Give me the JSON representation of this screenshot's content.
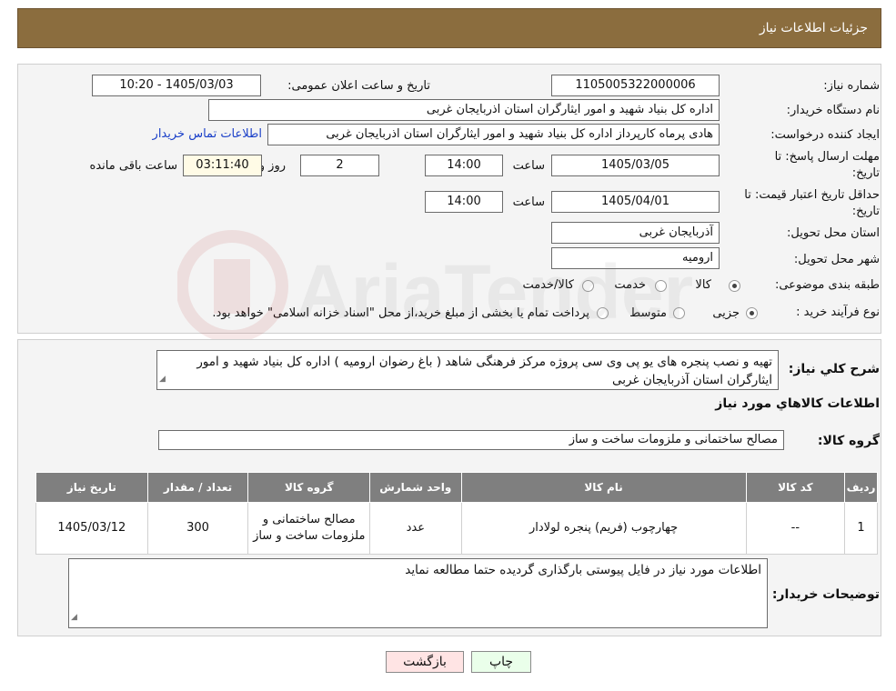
{
  "header": {
    "title": "جزئیات اطلاعات نیاز"
  },
  "form": {
    "need_number": {
      "label": "شماره نیاز:",
      "value": "1105005322000006"
    },
    "announce_datetime": {
      "label": "تاریخ و ساعت اعلان عمومی:",
      "value": "1405/03/03 - 10:20"
    },
    "buyer_org": {
      "label": "نام دستگاه خریدار:",
      "value": "اداره کل بنیاد شهید و امور ایثارگران استان اذربایجان غربی"
    },
    "requester": {
      "label": "ایجاد کننده درخواست:",
      "value": "هادی پرماه کارپرداز اداره کل بنیاد شهید و امور ایثارگران استان اذربایجان غربی",
      "link": "اطلاعات تماس خریدار"
    },
    "reply_deadline": {
      "label_line1": "مهلت ارسال پاسخ: تا",
      "label_line2": "تاریخ:",
      "date": "1405/03/05",
      "time_label": "ساعت",
      "time": "14:00",
      "days": "2",
      "days_label": "روز و",
      "remaining": "03:11:40",
      "remaining_label": "ساعت باقی مانده"
    },
    "price_validity": {
      "label_line1": "حداقل تاریخ اعتبار قیمت: تا",
      "label_line2": "تاریخ:",
      "date": "1405/04/01",
      "time_label": "ساعت",
      "time": "14:00"
    },
    "province": {
      "label": "استان محل تحویل:",
      "value": "آذربایجان غربی"
    },
    "city": {
      "label": "شهر محل تحویل:",
      "value": "ارومیه"
    },
    "category": {
      "label": "طبقه بندی موضوعی:",
      "options": [
        "کالا",
        "خدمت",
        "کالا/خدمت"
      ]
    },
    "purchase_type": {
      "label": "نوع فرآیند خرید :",
      "options": [
        "جزیی",
        "متوسط"
      ],
      "note": "پرداخت تمام یا بخشی از مبلغ خرید،از محل \"اسناد خزانه اسلامی\" خواهد بود."
    }
  },
  "summary": {
    "label": "شرح کلي نياز:",
    "value": "تهیه و نصب پنجره های یو پی وی سی پروژه مرکز فرهنگی شاهد ( باغ رضوان ارومیه ) اداره کل بنیاد شهید و امور ایثارگران استان آذربایجان غربی",
    "items_heading": "اطلاعات کالاهاي مورد نياز",
    "group_label": "گروه کالا:",
    "group_value": "مصالح ساختمانی و ملزومات ساخت و ساز"
  },
  "table": {
    "headers": [
      "رديف",
      "کد کالا",
      "نام کالا",
      "واحد شمارش",
      "گروه کالا",
      "تعداد / مقدار",
      "تاریخ نیاز"
    ],
    "row": {
      "index": "1",
      "code": "--",
      "name": "چهارچوب (فریم) پنجره لولادار",
      "unit": "عدد",
      "group": "مصالح ساختمانی و ملزومات ساخت و ساز",
      "qty": "300",
      "date": "1405/03/12"
    }
  },
  "buyer_notes": {
    "label": "توضیحات خریدار:",
    "value": "اطلاعات مورد نیاز در فایل پیوستی بارگذاری گردیده حتما مطالعه نماید"
  },
  "buttons": {
    "print": "چاپ",
    "back": "بازگشت"
  },
  "colors": {
    "header": "#8b6d3e",
    "link": "#1a3fc8",
    "table_header": "#7f7f7f",
    "print_btn": "#eaffea",
    "back_btn": "#ffe4e4"
  }
}
